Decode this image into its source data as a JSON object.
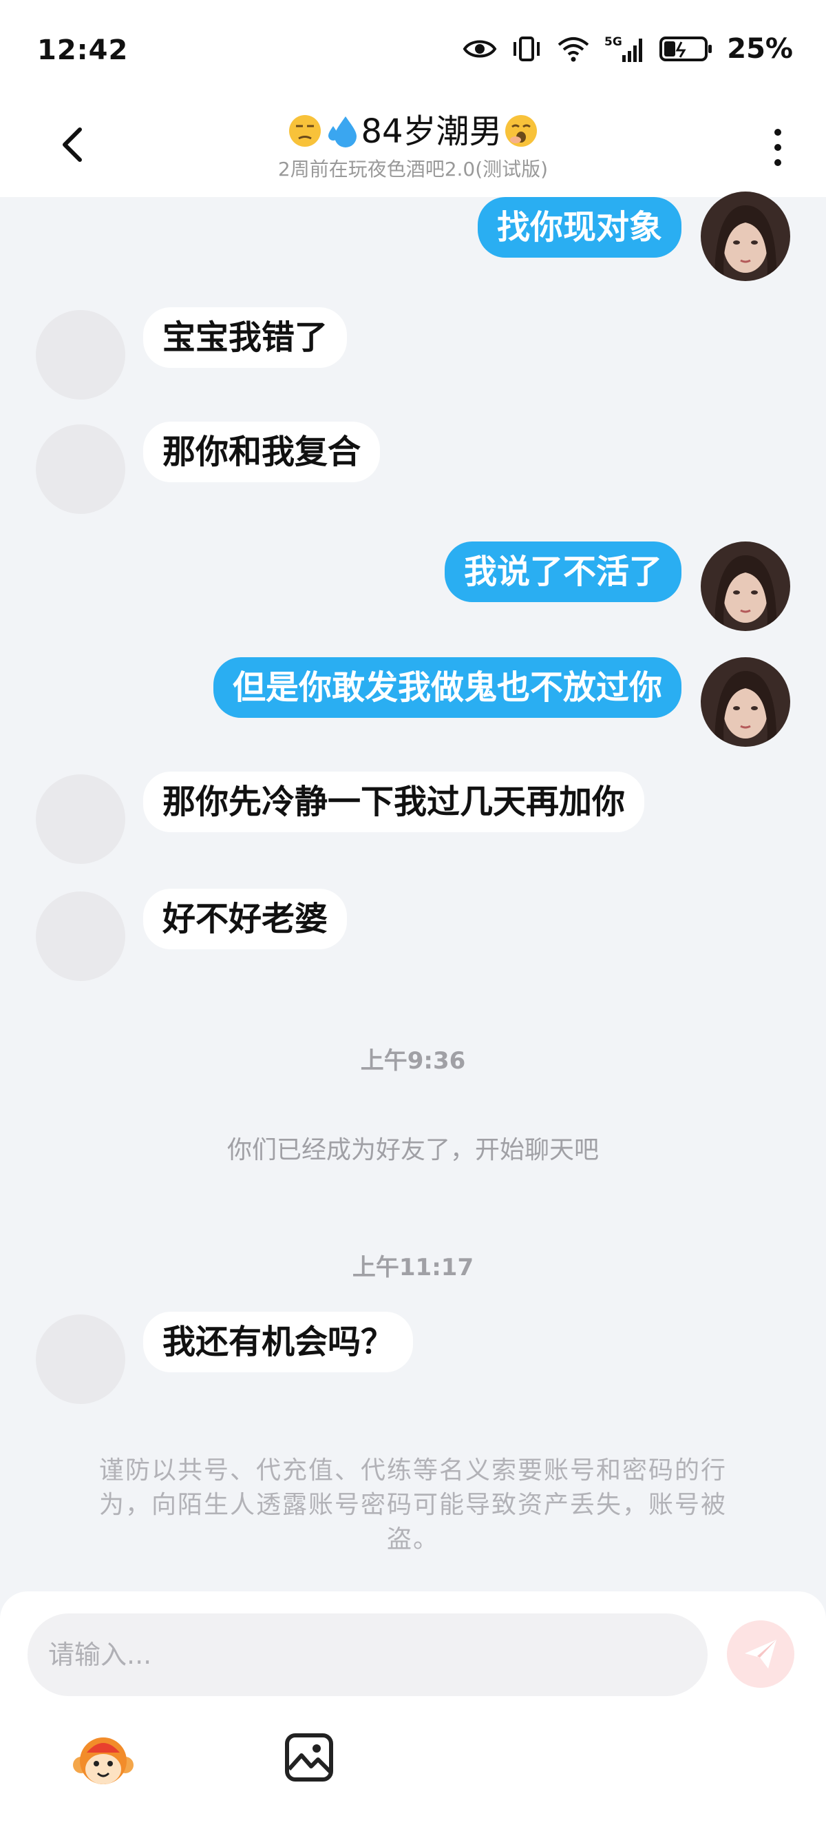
{
  "status_bar": {
    "time": "12:42",
    "network": "5G",
    "battery": "25%"
  },
  "header": {
    "title_name": "84岁潮男",
    "subtitle": "2周前在玩夜色酒吧2.0(测试版)",
    "title_emojis": [
      "unamused-face",
      "sweat-droplets",
      "yawning-face"
    ]
  },
  "messages": [
    {
      "side": "out",
      "text": "找你现对象"
    },
    {
      "side": "in",
      "text": "宝宝我错了"
    },
    {
      "side": "in",
      "text": "那你和我复合"
    },
    {
      "side": "out",
      "text": "我说了不活了"
    },
    {
      "side": "out",
      "text": "但是你敢发我做鬼也不放过你"
    },
    {
      "side": "in",
      "text": "那你先冷静一下我过几天再加你"
    },
    {
      "side": "in",
      "text": "好不好老婆"
    },
    {
      "side": "in",
      "text": "我还有机会吗？"
    }
  ],
  "timestamps": [
    "上午9:36",
    "上午11:17"
  ],
  "system_message": "你们已经成为好友了，开始聊天吧",
  "notice": "谨防以共号、代充值、代练等名义索要账号和密码的行为，向陌生人透露账号密码可能导致资产丢失，账号被盗。",
  "input": {
    "placeholder": "请输入..."
  },
  "colors": {
    "outgoing_bubble": "#2aaef2",
    "incoming_bubble": "#ffffff",
    "chat_background": "#f2f4f7",
    "send_button": "#fde3e3"
  }
}
